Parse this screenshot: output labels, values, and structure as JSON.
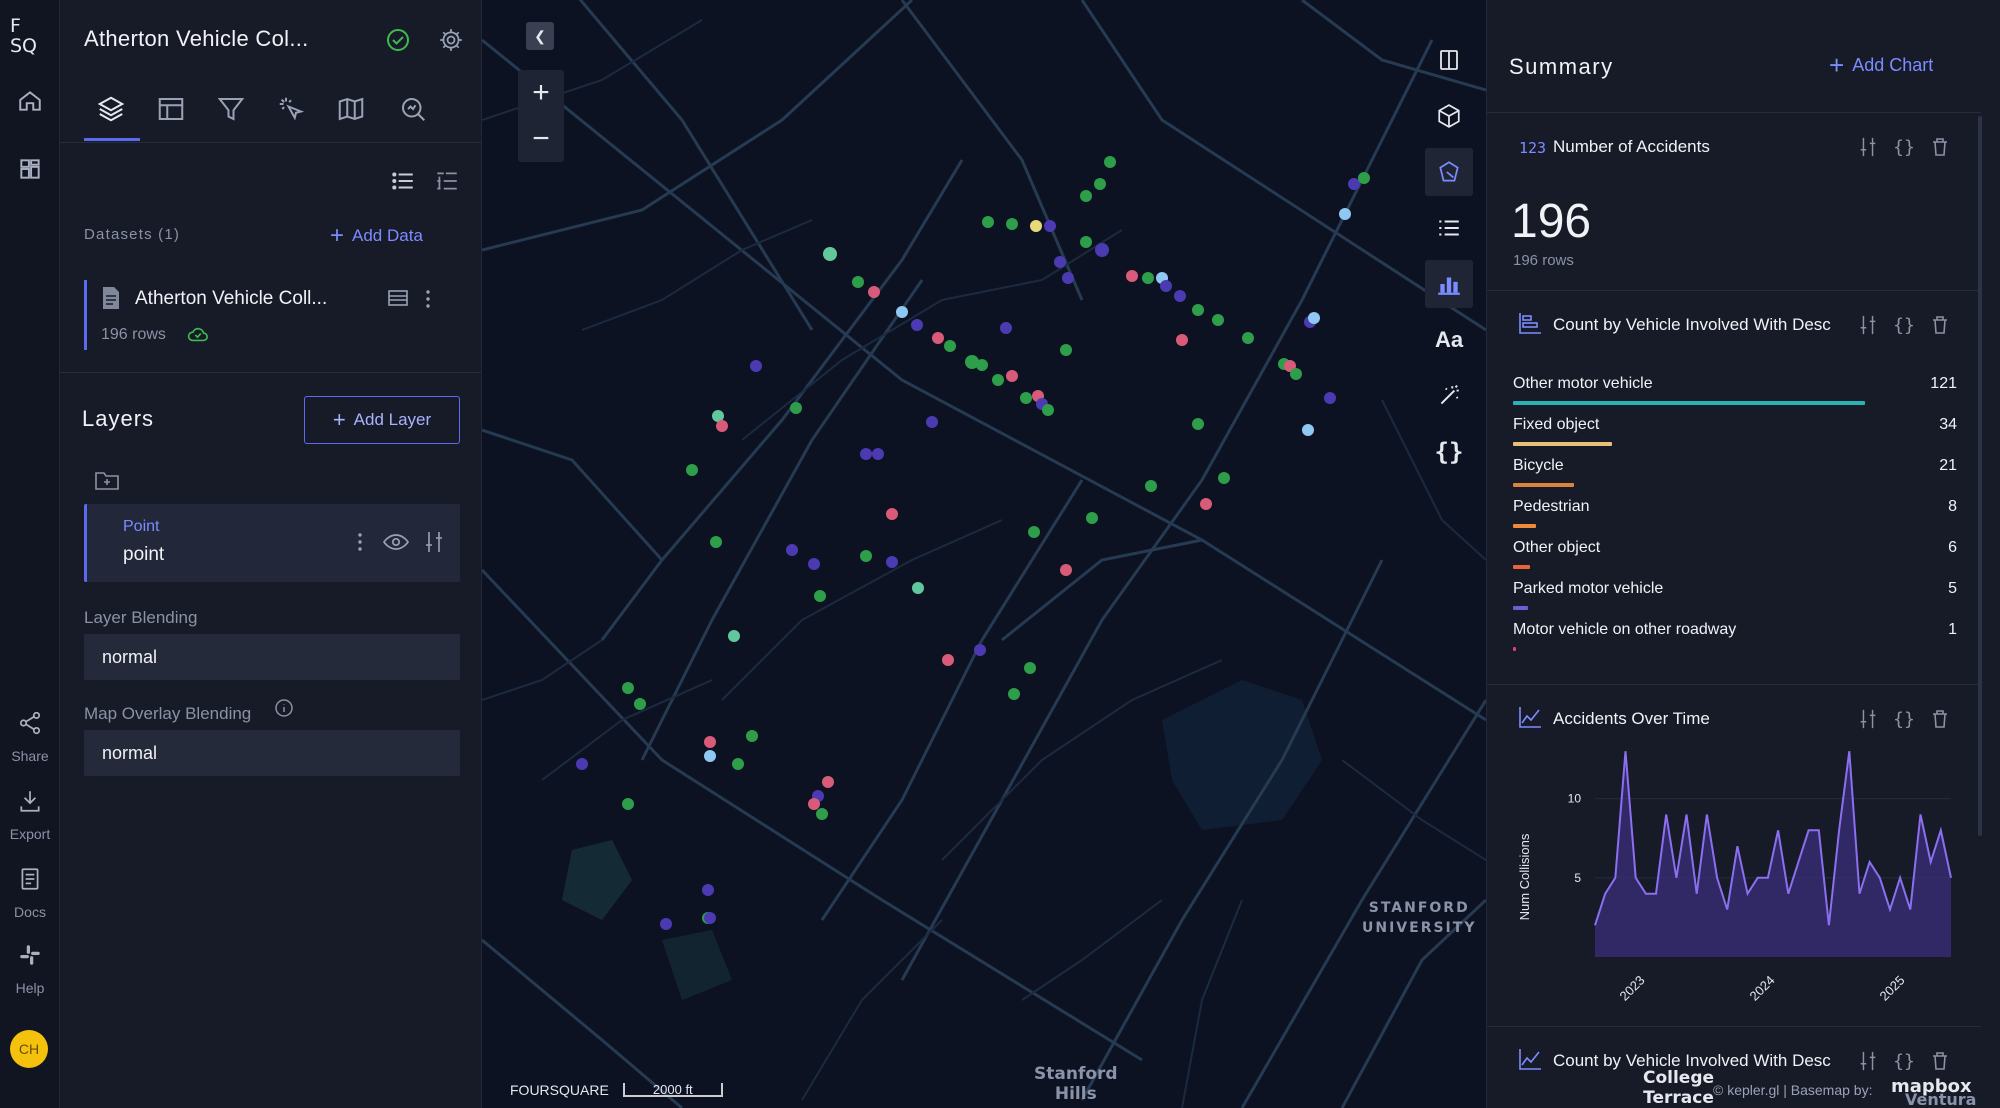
{
  "rail": {
    "logo": "F\nSQ",
    "share": "Share",
    "export": "Export",
    "docs": "Docs",
    "help": "Help",
    "avatar": "CH",
    "avatar_color": "#f4c20d"
  },
  "panel": {
    "title": "Atherton Vehicle Col...",
    "datasets_label": "Datasets (1)",
    "add_data": "Add Data",
    "dataset": {
      "name": "Atherton Vehicle Coll...",
      "rows": "196 rows"
    },
    "layers_title": "Layers",
    "add_layer": "Add Layer",
    "layer": {
      "type": "Point",
      "name": "point"
    },
    "layer_blending_label": "Layer Blending",
    "layer_blending_value": "normal",
    "overlay_blending_label": "Map Overlay Blending",
    "overlay_blending_value": "normal",
    "tabs": [
      "layers-icon",
      "table-icon",
      "filter-icon",
      "interaction-icon",
      "basemap-icon",
      "search-icon"
    ]
  },
  "map": {
    "labels": {
      "stanford_univ": "STANFORD\nUNIVERSITY",
      "stanford_hills": "Stanford\nHills",
      "college_terrace": "College\nTerrace",
      "ventura": "Ventura"
    },
    "attribution": "FOURSQUARE",
    "scale": "2000 ft",
    "credits": "© kepler.gl | Basemap by:",
    "mapbox": "mapbox",
    "toolbar": [
      "split-map-icon",
      "3d-cube-icon",
      "draw-polygon-icon",
      "legend-icon",
      "chart-icon",
      "text-icon",
      "magic-wand-icon",
      "code-icon"
    ]
  },
  "summary": {
    "title": "Summary",
    "add_chart": "Add Chart",
    "card1": {
      "badge": "123",
      "title": "Number of Accidents",
      "value": "196",
      "sub": "196 rows"
    },
    "card2": {
      "title": "Count by Vehicle Involved With Desc",
      "rows": [
        {
          "label": "Other motor vehicle",
          "value": "121",
          "color": "#2bb3b3"
        },
        {
          "label": "Fixed object",
          "value": "34",
          "color": "#e8c07a"
        },
        {
          "label": "Bicycle",
          "value": "21",
          "color": "#d9843c"
        },
        {
          "label": "Pedestrian",
          "value": "8",
          "color": "#f08a3c"
        },
        {
          "label": "Other object",
          "value": "6",
          "color": "#e8653c"
        },
        {
          "label": "Parked motor vehicle",
          "value": "5",
          "color": "#6b5fd8"
        },
        {
          "label": "Motor vehicle on other roadway",
          "value": "1",
          "color": "#e03c6a"
        }
      ]
    },
    "card3": {
      "title": "Accidents Over Time",
      "ylabel": "Num Collisions"
    },
    "card4": {
      "title": "Count by Vehicle Involved With Desc"
    }
  },
  "chart_data": {
    "type": "area",
    "title": "Accidents Over Time",
    "ylabel": "Num Collisions",
    "xlabel": "",
    "x_ticks": [
      "2023",
      "2024",
      "2025"
    ],
    "y_ticks": [
      5,
      10
    ],
    "ylim": [
      0,
      12
    ],
    "values": [
      2,
      4,
      5,
      13,
      5,
      4,
      4,
      9,
      5,
      9,
      4,
      9,
      5,
      3,
      7,
      4,
      5,
      5,
      8,
      4,
      6,
      8,
      8,
      2,
      8,
      13,
      4,
      6,
      5,
      3,
      5,
      3,
      9,
      6,
      8,
      5
    ]
  }
}
